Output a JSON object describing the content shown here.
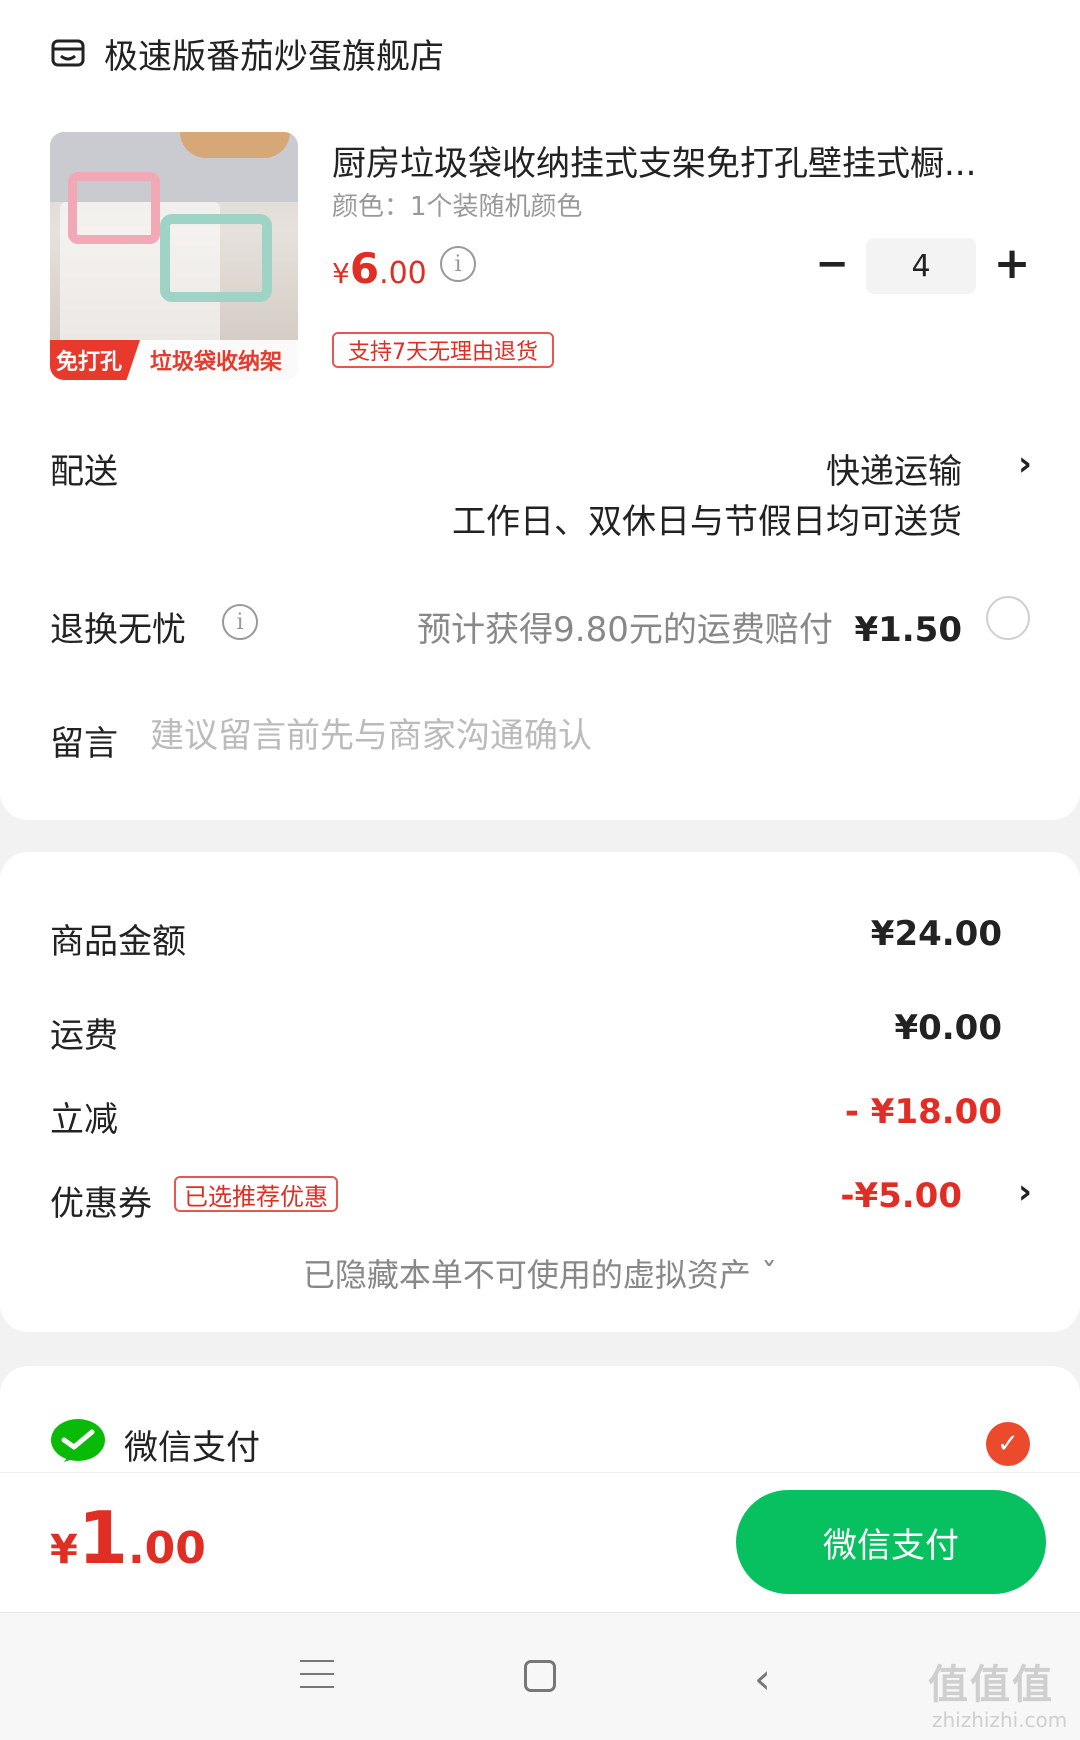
{
  "store": {
    "name": "极速版番茄炒蛋旗舰店",
    "icon": "store-icon"
  },
  "product": {
    "title": "厨房垃圾袋收纳挂式支架免打孔壁挂式橱...",
    "spec": "颜色：1个装随机颜色",
    "price_symbol": "¥",
    "price_int": "6",
    "price_dec": ".00",
    "quantity": "4",
    "minus": "−",
    "plus": "+",
    "return_policy": "支持7天无理由退货",
    "image_labels": {
      "badge": "免打孔",
      "text": "垃圾袋收纳架"
    }
  },
  "delivery": {
    "label": "配送",
    "method": "快递运输",
    "note": "工作日、双休日与节假日均可送货"
  },
  "returns": {
    "label": "退换无忧",
    "desc": "预计获得9.80元的运费赔付",
    "price": "¥1.50"
  },
  "message": {
    "label": "留言",
    "placeholder": "建议留言前先与商家沟通确认"
  },
  "summary": {
    "goods_label": "商品金额",
    "goods_value": "¥24.00",
    "shipping_label": "运费",
    "shipping_value": "¥0.00",
    "discount_label": "立减",
    "discount_value": "- ¥18.00",
    "coupon_label": "优惠券",
    "coupon_tag": "已选推荐优惠",
    "coupon_value": "-¥5.00",
    "hidden_assets": "已隐藏本单不可使用的虚拟资产 ˇ"
  },
  "payment": {
    "method": "微信支付",
    "selected": true
  },
  "footer": {
    "total_symbol": "¥",
    "total_int": "1",
    "total_dec": ".00",
    "pay_button": "微信支付"
  },
  "watermark": {
    "main": "值值值",
    "sub": "zhizhizhi.com"
  },
  "colors": {
    "price_red": "#e02e24",
    "wechat_green": "#07c160",
    "check_orange": "#ec4a2c"
  }
}
